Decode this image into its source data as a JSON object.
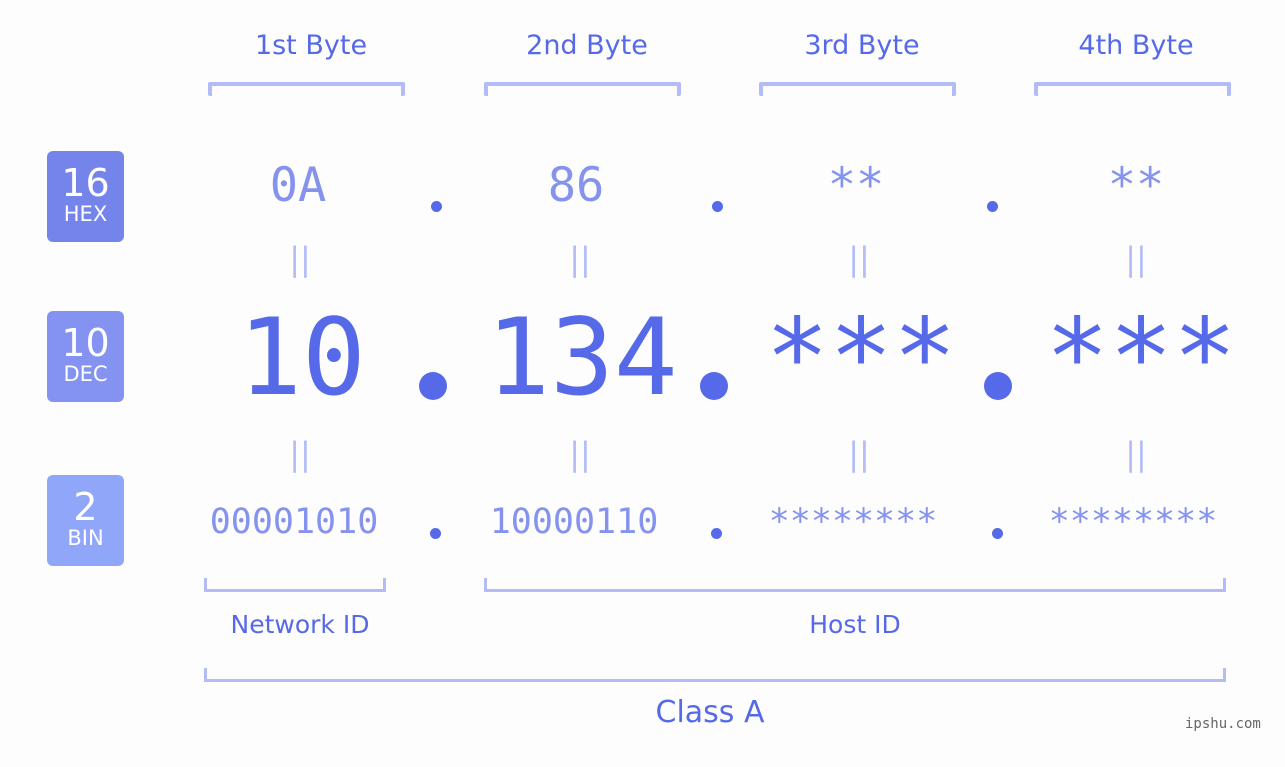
{
  "bytes": {
    "headers": [
      "1st Byte",
      "2nd Byte",
      "3rd Byte",
      "4th Byte"
    ],
    "hex": [
      "0A",
      "86",
      "**",
      "**"
    ],
    "dec": [
      "10",
      "134",
      "***",
      "***"
    ],
    "bin": [
      "00001010",
      "10000110",
      "********",
      "********"
    ]
  },
  "badges": {
    "hex": {
      "number": "16",
      "label": "HEX",
      "color": "#7484ea"
    },
    "dec": {
      "number": "10",
      "label": "DEC",
      "color": "#8493f1"
    },
    "bin": {
      "number": "2",
      "label": "BIN",
      "color": "#8fa6f9"
    }
  },
  "symbols": {
    "equals": "||"
  },
  "sections": {
    "network": "Network ID",
    "host": "Host ID",
    "class": "Class A"
  },
  "watermark": "ipshu.com",
  "colors": {
    "accent": "#5669e8",
    "secondary": "#8593ee",
    "bracket": "#b3bcf6"
  }
}
